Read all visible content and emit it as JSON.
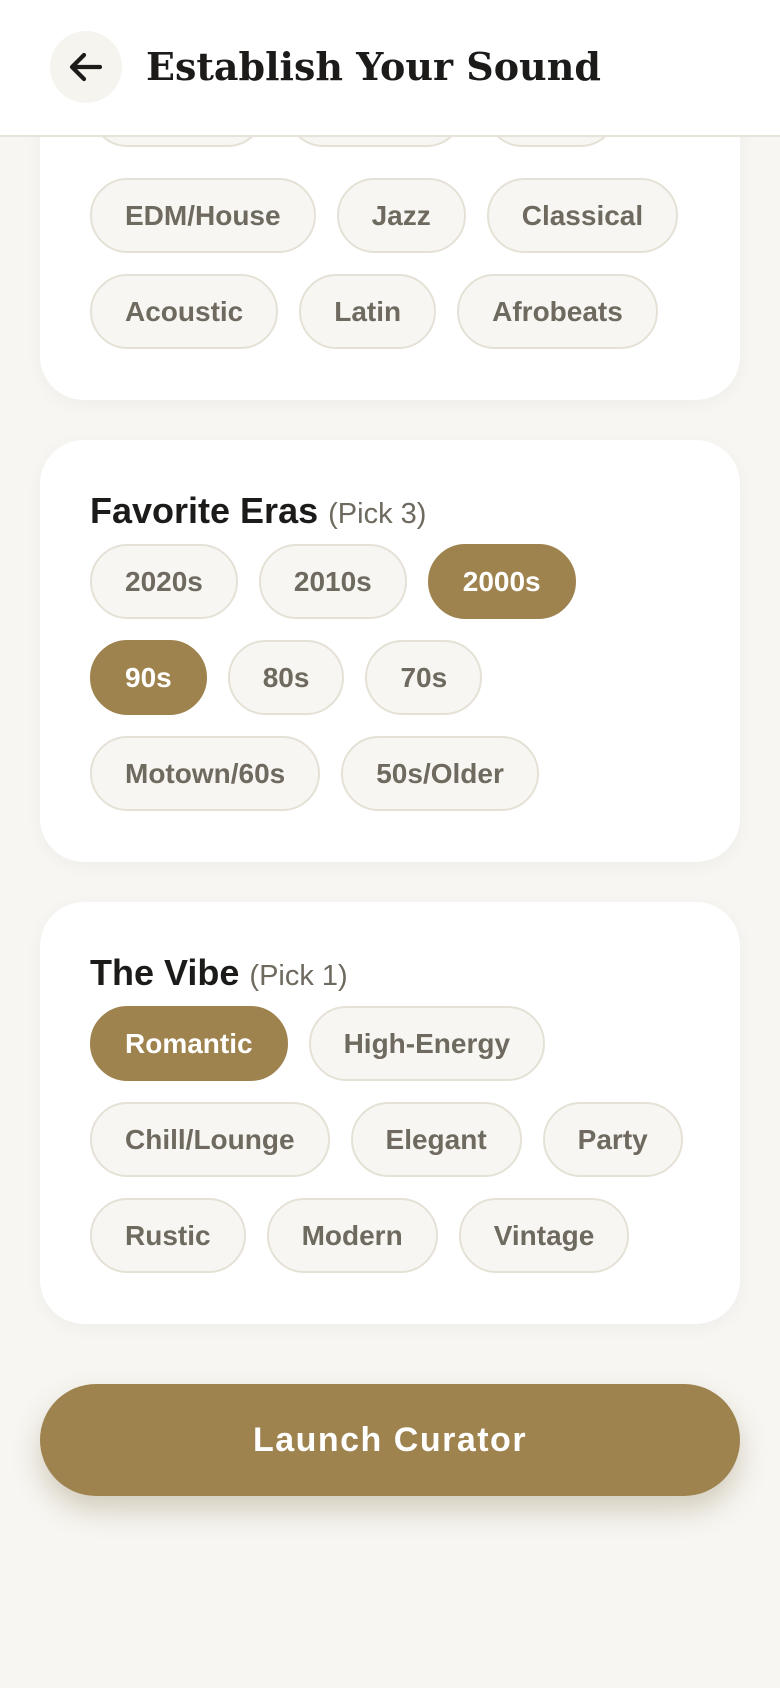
{
  "header": {
    "title": "Establish Your Sound",
    "back_icon": "arrow-left-icon"
  },
  "genres": {
    "partial_row": [
      "",
      "",
      ""
    ],
    "rows": [
      [
        "EDM/House",
        "Jazz",
        "Classical"
      ],
      [
        "Acoustic",
        "Latin",
        "Afrobeats"
      ]
    ]
  },
  "eras": {
    "title": "Favorite Eras",
    "hint": "(Pick 3)",
    "rows": [
      [
        "2020s",
        "2010s",
        "2000s"
      ],
      [
        "90s",
        "80s",
        "70s"
      ],
      [
        "Motown/60s",
        "50s/Older"
      ]
    ],
    "selected": [
      "2000s",
      "90s"
    ]
  },
  "vibe": {
    "title": "The Vibe",
    "hint": "(Pick 1)",
    "rows": [
      [
        "Romantic",
        "High-Energy"
      ],
      [
        "Chill/Lounge",
        "Elegant",
        "Party"
      ],
      [
        "Rustic",
        "Modern",
        "Vintage"
      ]
    ],
    "selected": [
      "Romantic"
    ]
  },
  "launch": {
    "label": "Launch Curator"
  },
  "colors": {
    "accent": "#9e834f",
    "background": "#f7f6f2",
    "chip_bg": "#f7f6f2",
    "chip_border": "#e5e1d6",
    "chip_text": "#6f6a5f",
    "title_text": "#1c1b19"
  }
}
